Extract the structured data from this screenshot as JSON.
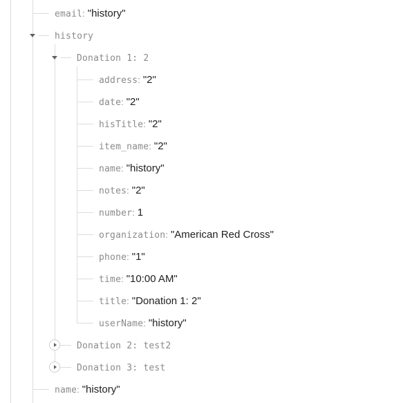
{
  "tree": [
    {
      "key": "email",
      "value": "\"history\"",
      "level": 1
    },
    {
      "key": "history",
      "level": 1,
      "expand": "expanded"
    },
    {
      "key": "Donation 1: 2",
      "level": 2,
      "expand": "expanded"
    },
    {
      "key": "address",
      "value": "\"2\"",
      "level": 3
    },
    {
      "key": "date",
      "value": "\"2\"",
      "level": 3
    },
    {
      "key": "hisTitle",
      "value": "\"2\"",
      "level": 3
    },
    {
      "key": "item_name",
      "value": "\"2\"",
      "level": 3
    },
    {
      "key": "name",
      "value": "\"history\"",
      "level": 3
    },
    {
      "key": "notes",
      "value": "\"2\"",
      "level": 3
    },
    {
      "key": "number",
      "value": "1",
      "level": 3
    },
    {
      "key": "organization",
      "value": "\"American Red Cross\"",
      "level": 3
    },
    {
      "key": "phone",
      "value": "\"1\"",
      "level": 3
    },
    {
      "key": "time",
      "value": "\"10:00 AM\"",
      "level": 3
    },
    {
      "key": "title",
      "value": "\"Donation 1: 2\"",
      "level": 3
    },
    {
      "key": "userName",
      "value": "\"history\"",
      "level": 3
    },
    {
      "key": "Donation 2: test2",
      "level": 2,
      "expand": "collapsed"
    },
    {
      "key": "Donation 3: test",
      "level": 2,
      "expand": "collapsed"
    },
    {
      "key": "name",
      "value": "\"history\"",
      "level": 1
    }
  ]
}
